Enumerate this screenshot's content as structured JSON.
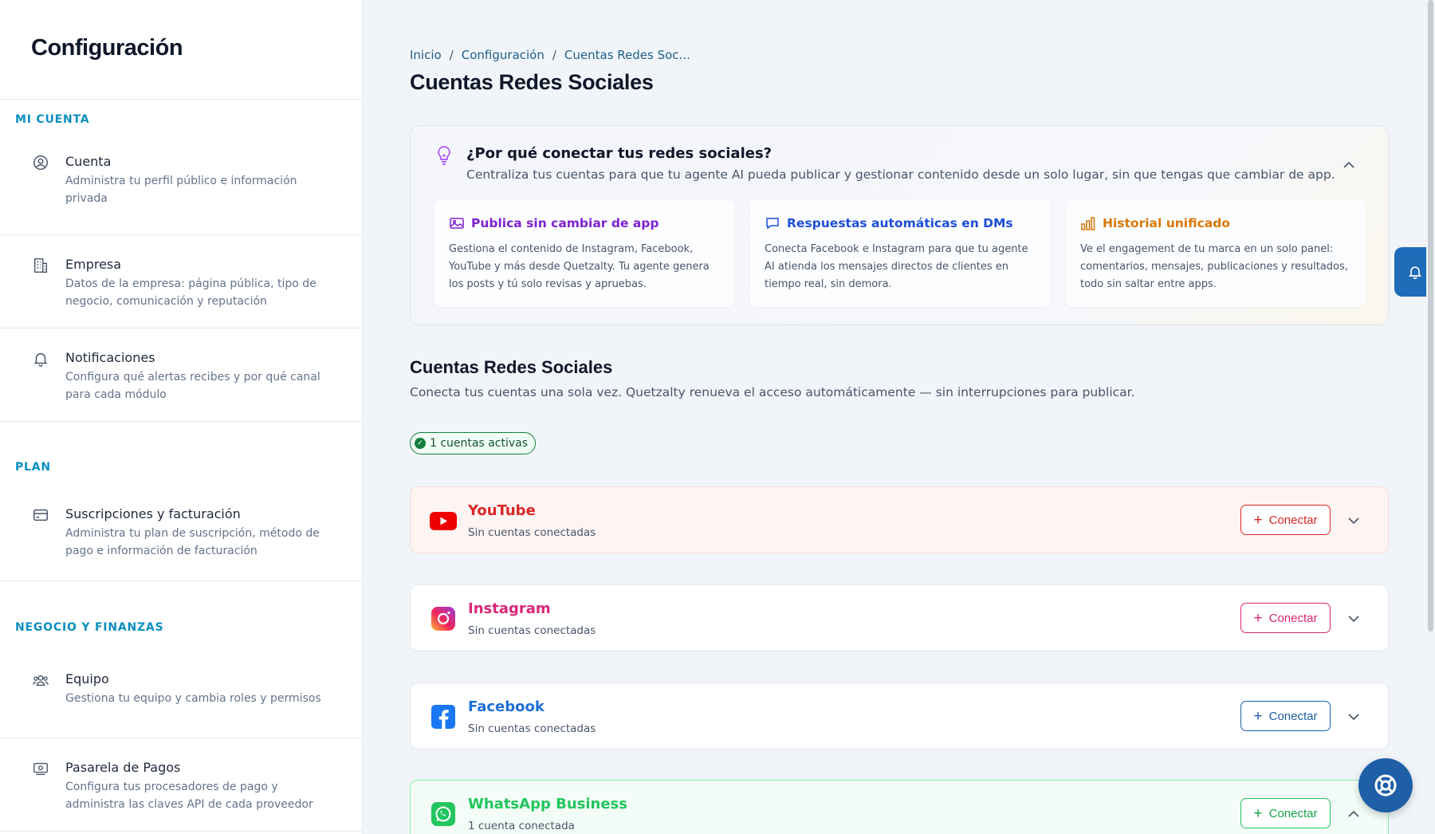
{
  "sidebar": {
    "title": "Configuración",
    "sections": {
      "mi_cuenta": "MI CUENTA",
      "plan": "PLAN",
      "negocio": "NEGOCIO Y FINANZAS"
    },
    "items": [
      {
        "title": "Cuenta",
        "desc": "Administra tu perfil público e información privada",
        "icon": "user-circle-icon"
      },
      {
        "title": "Empresa",
        "desc": "Datos de la empresa: página pública, tipo de negocio, comunicación y reputación",
        "icon": "building-icon"
      },
      {
        "title": "Notificaciones",
        "desc": "Configura qué alertas recibes y por qué canal para cada módulo",
        "icon": "bell-icon"
      },
      {
        "title": "Suscripciones y facturación",
        "desc": "Administra tu plan de suscripción, método de pago e información de facturación",
        "icon": "credit-card-icon"
      },
      {
        "title": "Equipo",
        "desc": "Gestiona tu equipo y cambia roles y permisos",
        "icon": "users-icon"
      },
      {
        "title": "Pasarela de Pagos",
        "desc": "Configura tus procesadores de pago y administra las claves API de cada proveedor",
        "icon": "payment-gateway-icon"
      }
    ]
  },
  "breadcrumb": [
    "Inicio",
    "Configuración",
    "Cuentas Redes Soc..."
  ],
  "page_title": "Cuentas Redes Sociales",
  "why": {
    "title": "¿Por qué conectar tus redes sociales?",
    "subtitle": "Centraliza tus cuentas para que tu agente AI pueda publicar y gestionar contenido desde un solo lugar, sin que tengas que cambiar de app.",
    "features": [
      {
        "title": "Publica sin cambiar de app",
        "desc": "Gestiona el contenido de Instagram, Facebook, YouTube y más desde Quetzalty. Tu agente genera los posts y tú solo revisas y apruebas.",
        "color": "#7e22ce"
      },
      {
        "title": "Respuestas automáticas en DMs",
        "desc": "Conecta Facebook e Instagram para que tu agente AI atienda los mensajes directos de clientes en tiempo real, sin demora.",
        "color": "#1d4ed8"
      },
      {
        "title": "Historial unificado",
        "desc": "Ve el engagement de tu marca en un solo panel: comentarios, mensajes, publicaciones y resultados, todo sin saltar entre apps.",
        "color": "#d97706"
      }
    ]
  },
  "accounts_section": {
    "title": "Cuentas Redes Sociales",
    "subtitle": "Conecta tus cuentas una sola vez. Quetzalty renueva el acceso automáticamente — sin interrupciones para publicar.",
    "badge": "1 cuentas activas"
  },
  "accounts": [
    {
      "name": "YouTube",
      "status": "Sin cuentas conectadas",
      "button": "Conectar",
      "color": "#dc2626",
      "bg": "#fef4f2",
      "border": "#f5dcd8"
    },
    {
      "name": "Instagram",
      "status": "Sin cuentas conectadas",
      "button": "Conectar",
      "color": "#db2777",
      "bg": "#ffffff",
      "border": "#e2e8f0"
    },
    {
      "name": "Facebook",
      "status": "Sin cuentas conectadas",
      "button": "Conectar",
      "color": "#1d6fd8",
      "bg": "#ffffff",
      "border": "#e2e8f0"
    },
    {
      "name": "WhatsApp Business",
      "status": "1 cuenta conectada",
      "button": "Conectar",
      "color": "#22c55e",
      "bg": "#f3fcf6",
      "border": "#86efac"
    }
  ]
}
